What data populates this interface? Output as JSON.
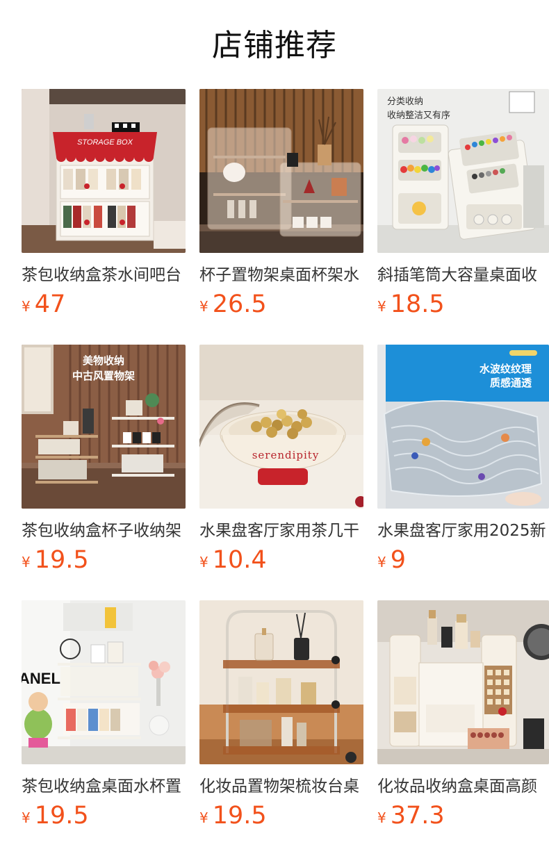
{
  "page": {
    "title": "店铺推荐"
  },
  "products": [
    {
      "name": "茶包收纳盒茶水间吧台",
      "currency": "¥",
      "price": "47",
      "image": "storage-box-shelf-photo"
    },
    {
      "name": "杯子置物架桌面杯架水",
      "currency": "¥",
      "price": "26.5",
      "image": "cup-rack-photo"
    },
    {
      "name": "斜插笔筒大容量桌面收",
      "currency": "¥",
      "price": "18.5",
      "image": "pen-holder-photo"
    },
    {
      "name": "茶包收纳盒杯子收纳架",
      "currency": "¥",
      "price": "19.5",
      "image": "vintage-shelf-photo"
    },
    {
      "name": "水果盘客厅家用茶几干",
      "currency": "¥",
      "price": "10.4",
      "image": "fruit-plate-photo"
    },
    {
      "name": "水果盘客厅家用2025新",
      "currency": "¥",
      "price": "9",
      "image": "glass-tray-photo"
    },
    {
      "name": "茶包收纳盒桌面水杯置",
      "currency": "¥",
      "price": "19.5",
      "image": "acrylic-shelf-photo"
    },
    {
      "name": "化妆品置物架梳妆台桌",
      "currency": "¥",
      "price": "19.5",
      "image": "cosmetic-rack-photo"
    },
    {
      "name": "化妆品收纳盒桌面高颜",
      "currency": "¥",
      "price": "37.3",
      "image": "cosmetic-box-photo"
    }
  ],
  "image_text": {
    "p1_sign": "STORAGE BOX",
    "p3_caption_1": "分类收纳",
    "p3_caption_2": "收纳整洁又有序",
    "p4_caption_1": "美物收纳",
    "p4_caption_2": "中古风置物架",
    "p5_bowl": "serendipity",
    "p6_caption_1": "水波纹纹理",
    "p6_caption_2": "质感通透",
    "p7_wall": "ANEL"
  },
  "colors": {
    "price": "#f2511b",
    "title": "#111111",
    "name": "#333333"
  }
}
